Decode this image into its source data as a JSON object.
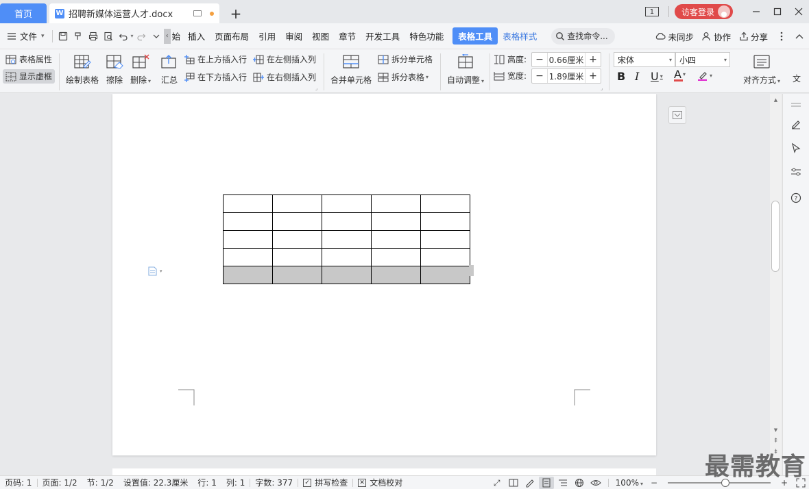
{
  "titlebar": {
    "home_tab": "首页",
    "doc_tab": "招聘新媒体运营人才.docx",
    "window_count": "1",
    "login_label": "访客登录"
  },
  "menubar": {
    "file_label": "文件",
    "scroll_fragment": "始",
    "items": [
      "插入",
      "页面布局",
      "引用",
      "审阅",
      "视图",
      "章节",
      "开发工具",
      "特色功能"
    ],
    "active_tab": "表格工具",
    "style_tab": "表格样式",
    "search_label": "查找命令...",
    "sync_label": "未同步",
    "collab_label": "协作",
    "share_label": "分享"
  },
  "ribbon": {
    "table_props": "表格属性",
    "show_grid": "显示虚框",
    "draw_table": "绘制表格",
    "erase": "擦除",
    "delete": "删除",
    "summary": "汇总",
    "insert_above": "在上方插入行",
    "insert_below": "在下方插入行",
    "insert_left": "在左侧插入列",
    "insert_right": "在右侧插入列",
    "merge_cells": "合并单元格",
    "split_cells": "拆分单元格",
    "split_table": "拆分表格",
    "auto_fit": "自动调整",
    "height_label": "高度:",
    "height_value": "0.66厘米",
    "width_label": "宽度:",
    "width_value": "1.89厘米",
    "font_name": "宋体",
    "font_size": "小四",
    "align": "对齐方式",
    "text_dir": "文"
  },
  "document": {
    "table_rows": 5,
    "table_cols": 5,
    "selected_row": 4
  },
  "statusbar": {
    "page_no": "页码: 1",
    "pages": "页面: 1/2",
    "section": "节: 1/2",
    "position": "设置值: 22.3厘米",
    "row": "行: 1",
    "col": "列: 1",
    "word_count": "字数: 377",
    "spell_check": "拼写检查",
    "doc_proof": "文档校对",
    "zoom": "100%",
    "zoom_fraction": 0.56
  },
  "watermark": "最需教育",
  "colors": {
    "accent": "#4f8ef7",
    "login": "#e04a4a",
    "selection": "#c8c8c8"
  }
}
